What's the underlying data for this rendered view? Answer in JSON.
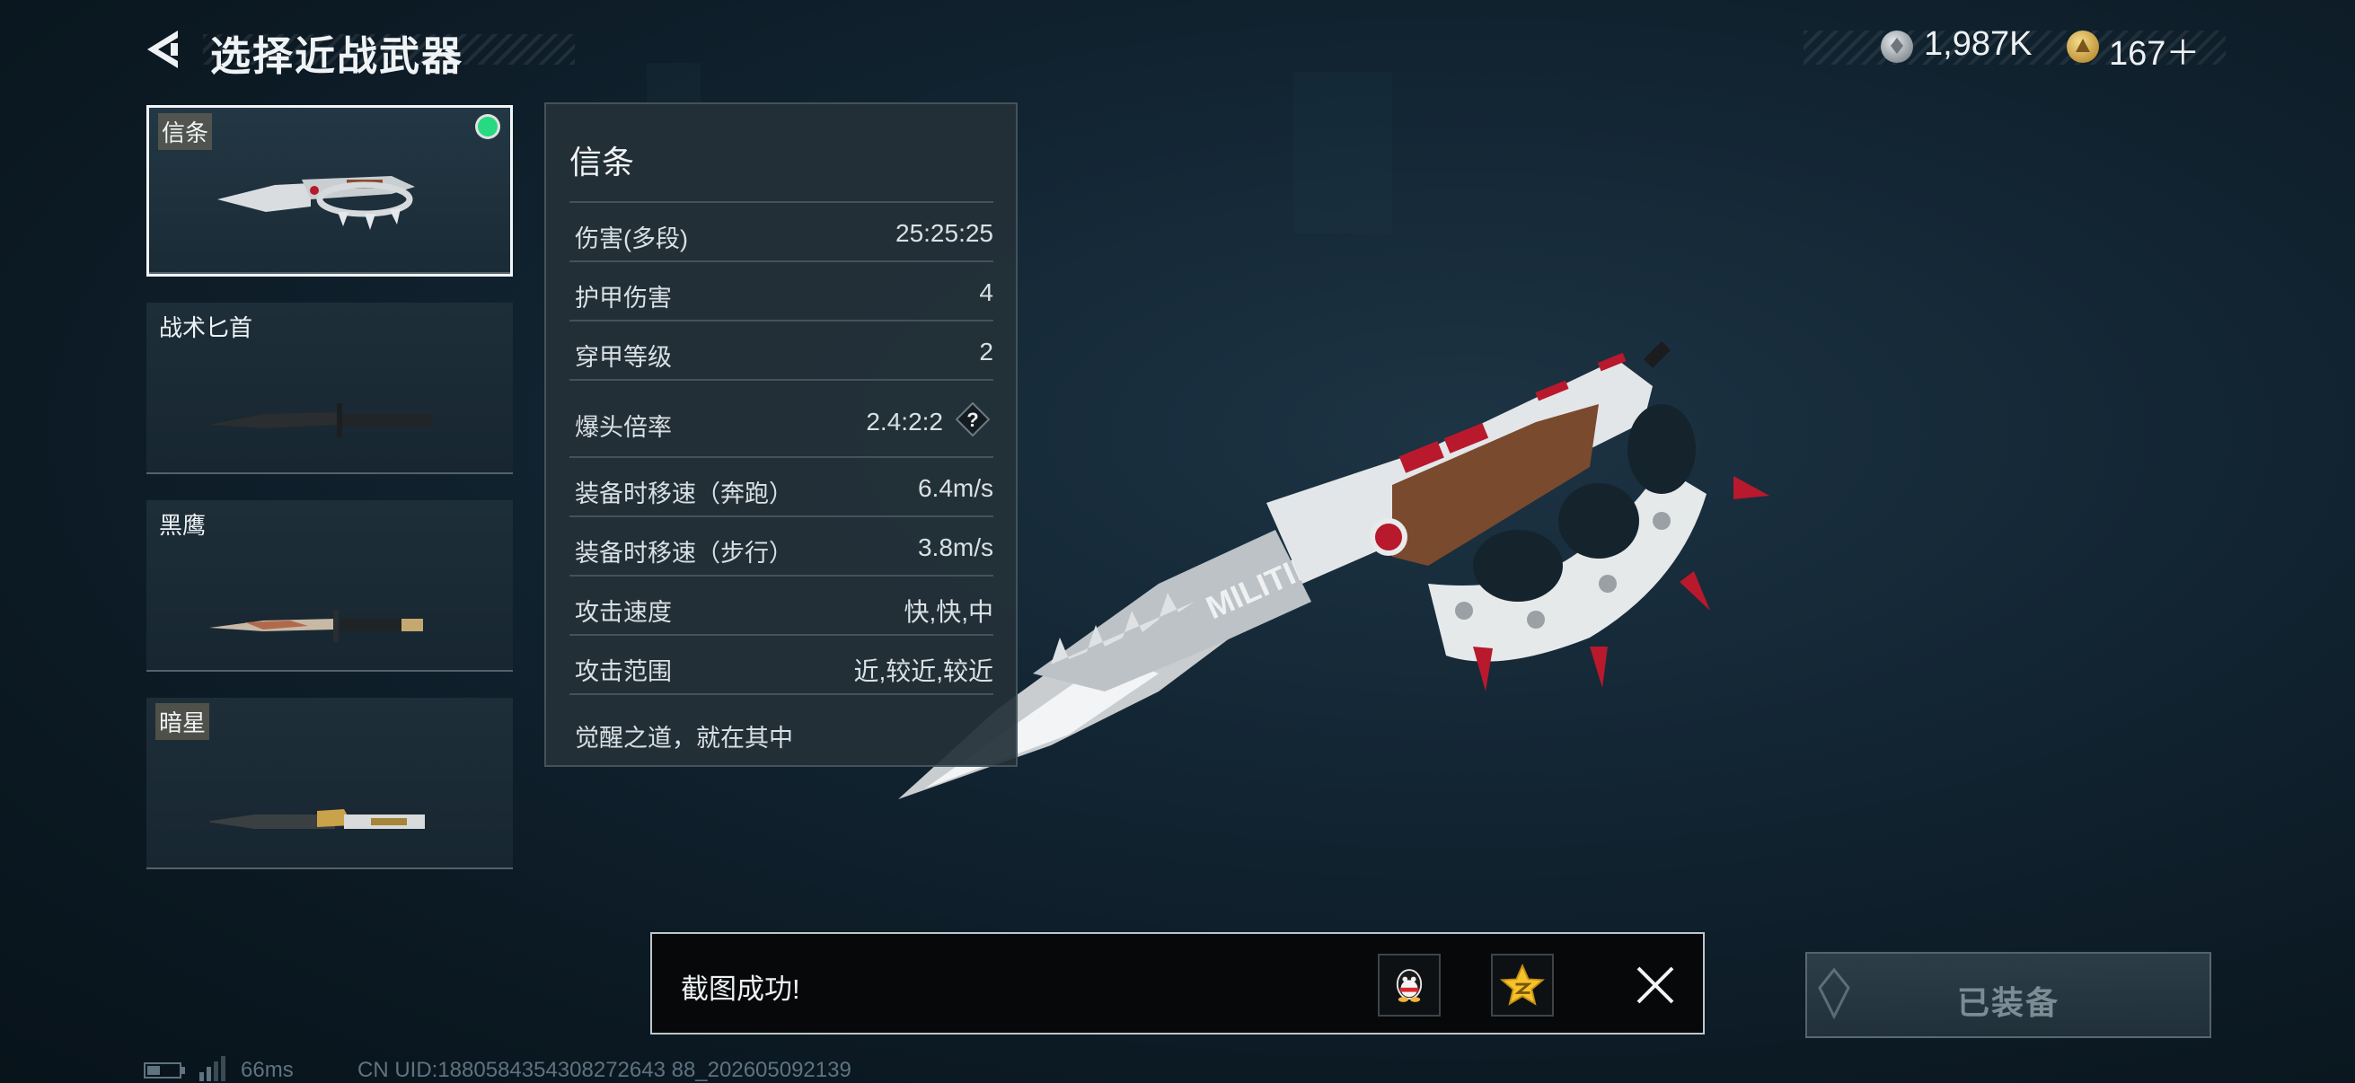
{
  "header": {
    "title": "选择近战武器",
    "back_icon": "back-arrow-icon",
    "currency": [
      {
        "icon": "silver-coin-icon",
        "value": "1,987K"
      },
      {
        "icon": "gold-coin-icon",
        "value": "167＋"
      }
    ]
  },
  "weapons": [
    {
      "label": "信条",
      "selected": true,
      "equipped": true
    },
    {
      "label": "战术匕首",
      "selected": false,
      "equipped": false
    },
    {
      "label": "黑鹰",
      "selected": false,
      "equipped": false
    },
    {
      "label": "暗星",
      "selected": false,
      "equipped": false
    }
  ],
  "stats": {
    "title": "信条",
    "rows": [
      {
        "name": "伤害(多段)",
        "value": "25:25:25"
      },
      {
        "name": "护甲伤害",
        "value": "4"
      },
      {
        "name": "穿甲等级",
        "value": "2"
      },
      {
        "name": "爆头倍率",
        "value": "2.4:2:2",
        "help": "?"
      },
      {
        "name": "装备时移速（奔跑）",
        "value": "6.4m/s"
      },
      {
        "name": "装备时移速（步行）",
        "value": "3.8m/s"
      },
      {
        "name": "攻击速度",
        "value": "快,快,中"
      },
      {
        "name": "攻击范围",
        "value": "近,较近,较近"
      }
    ],
    "description": "觉醒之道，就在其中"
  },
  "weapon_engraving": "MILITIEDS",
  "toast": {
    "text": "截图成功!",
    "actions": [
      "qq-share-icon",
      "qzone-share-icon"
    ],
    "close_icon": "close-icon"
  },
  "equip_button": {
    "label": "已装备"
  },
  "footer": {
    "ping": "66ms",
    "uid": "CN UID:1880584354308272643 88_202605092139"
  },
  "colors": {
    "equipped_indicator": "#27d980",
    "accent_red": "#b8192c"
  }
}
